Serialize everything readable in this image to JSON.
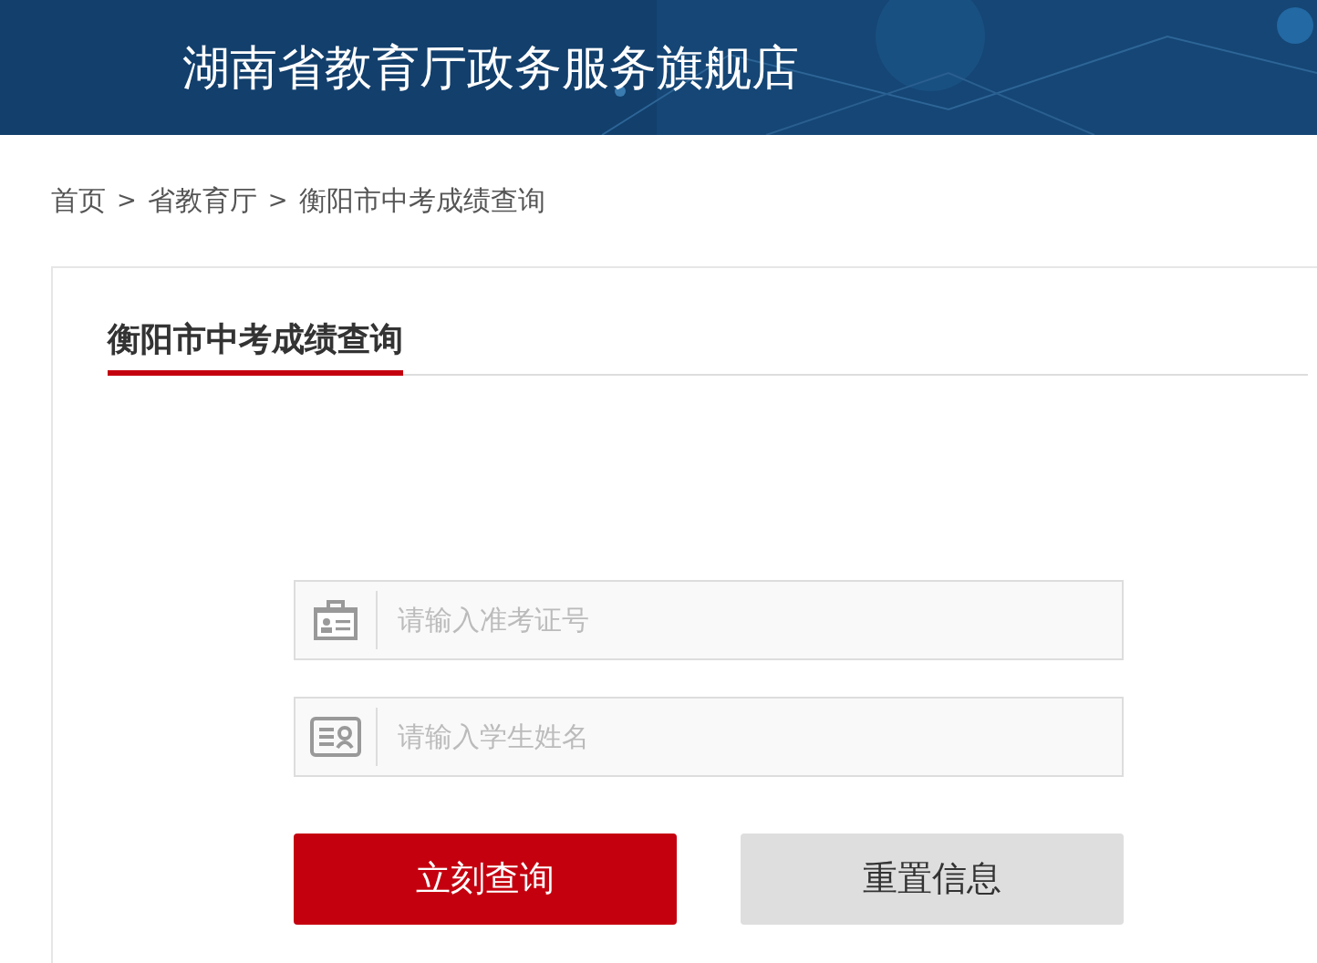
{
  "header": {
    "title": "湖南省教育厅政务服务旗舰店"
  },
  "breadcrumb": [
    {
      "kind": "link",
      "label": "首页"
    },
    {
      "kind": "separator",
      "label": ">"
    },
    {
      "kind": "link",
      "label": "省教育厅"
    },
    {
      "kind": "separator",
      "label": ">"
    },
    {
      "kind": "current",
      "label": "衡阳市中考成绩查询"
    }
  ],
  "panel": {
    "tab": {
      "label": "衡阳市中考成绩查询",
      "selected": true
    }
  },
  "fields": [
    {
      "kind": "ticket",
      "placeholder": "请输入准考证号"
    },
    {
      "kind": "card",
      "placeholder": "请输入学生姓名"
    }
  ],
  "buttons": [
    {
      "kind": "primary",
      "label": "立刻查询"
    },
    {
      "kind": "secondary",
      "label": "重置信息"
    }
  ]
}
